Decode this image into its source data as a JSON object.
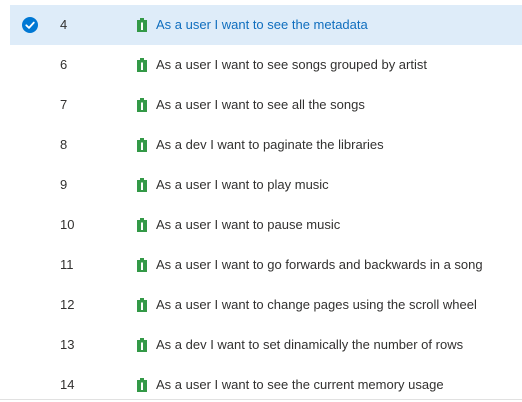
{
  "work_items": [
    {
      "id": "4",
      "title": "As a user I want to see the metadata",
      "selected": true
    },
    {
      "id": "6",
      "title": "As a user I want to see songs grouped by artist",
      "selected": false
    },
    {
      "id": "7",
      "title": "As a user I want to see all the songs",
      "selected": false
    },
    {
      "id": "8",
      "title": "As a dev I want to paginate the libraries",
      "selected": false
    },
    {
      "id": "9",
      "title": "As a user I want to play music",
      "selected": false
    },
    {
      "id": "10",
      "title": "As a user I want to pause music",
      "selected": false
    },
    {
      "id": "11",
      "title": "As a user I want to go forwards and backwards in a song",
      "selected": false
    },
    {
      "id": "12",
      "title": "As a user I want to change pages using the scroll wheel",
      "selected": false
    },
    {
      "id": "13",
      "title": "As a dev I want to set dinamically the number of rows",
      "selected": false
    },
    {
      "id": "14",
      "title": "As a user I want to see the current memory usage",
      "selected": false
    }
  ],
  "icons": {
    "selected_check": "check-circle-icon",
    "work_item_type": "user-story-icon"
  },
  "colors": {
    "selection_background": "#deecf9",
    "selected_check": "#0078d4",
    "selected_title": "#106ebe",
    "text": "#323130",
    "user_story_icon": "#339947"
  }
}
